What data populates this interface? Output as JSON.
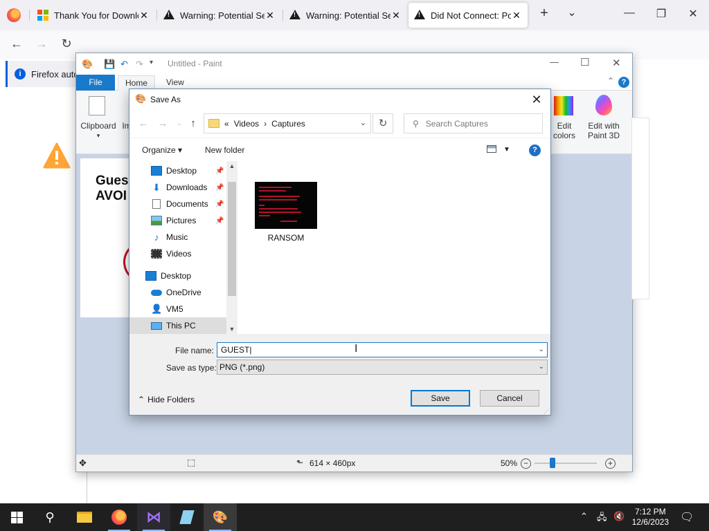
{
  "firefox": {
    "tabs": [
      {
        "title": "Thank You for Downlo",
        "icon": "microsoft-logo-icon"
      },
      {
        "title": "Warning: Potential Sec",
        "icon": "warning-icon"
      },
      {
        "title": "Warning: Potential Sec",
        "icon": "warning-icon"
      },
      {
        "title": "Did Not Connect: Pote",
        "icon": "warning-icon",
        "active": true
      }
    ],
    "new_tab": "+",
    "tab_list": "⌄",
    "notification": "Firefox auto",
    "window_controls": {
      "minimize": "—",
      "restore": "❐",
      "close": "✕"
    }
  },
  "paint": {
    "title": "Untitled - Paint",
    "menu": {
      "file": "File",
      "home": "Home",
      "view": "View"
    },
    "ribbon": {
      "clipboard": "Clipboard",
      "image_partial": "Im",
      "edit_colors": "Edit\ncolors",
      "edit_paint3d": "Edit with\nPaint 3D"
    },
    "canvas_text": "Gues\nAVOI",
    "status": {
      "size": "614 × 460px",
      "zoom": "50%"
    },
    "window_controls": {
      "minimize": "—",
      "maximize": "☐",
      "close": "✕"
    }
  },
  "dialog": {
    "title": "Save As",
    "breadcrumb": {
      "prefix": "«",
      "parts": [
        "Videos",
        "Captures"
      ],
      "sep": "›"
    },
    "search_placeholder": "Search Captures",
    "commands": {
      "organize": "Organize ▾",
      "new_folder": "New folder"
    },
    "tree": [
      {
        "label": "Desktop",
        "icon": "desktop-icon",
        "pinned": true
      },
      {
        "label": "Downloads",
        "icon": "downloads-icon",
        "pinned": true
      },
      {
        "label": "Documents",
        "icon": "documents-icon",
        "pinned": true
      },
      {
        "label": "Pictures",
        "icon": "pictures-icon",
        "pinned": true
      },
      {
        "label": "Music",
        "icon": "music-icon"
      },
      {
        "label": "Videos",
        "icon": "videos-icon"
      },
      {
        "label": "Desktop",
        "icon": "desktop-icon"
      },
      {
        "label": "OneDrive",
        "icon": "onedrive-icon"
      },
      {
        "label": "VM5",
        "icon": "user-icon"
      },
      {
        "label": "This PC",
        "icon": "this-pc-icon",
        "selected": true
      }
    ],
    "files": [
      {
        "name": "RANSOM"
      }
    ],
    "file_name_label": "File name:",
    "file_name_value": "GUEST|",
    "save_type_label": "Save as type:",
    "save_type_value": "PNG (*.png)",
    "hide_folders": "Hide Folders",
    "save": "Save",
    "cancel": "Cancel"
  },
  "taskbar": {
    "time": "7:12 PM",
    "date": "12/6/2023",
    "apps": [
      "start",
      "search",
      "file-explorer",
      "firefox",
      "visual-studio",
      "notepad",
      "paint"
    ]
  }
}
